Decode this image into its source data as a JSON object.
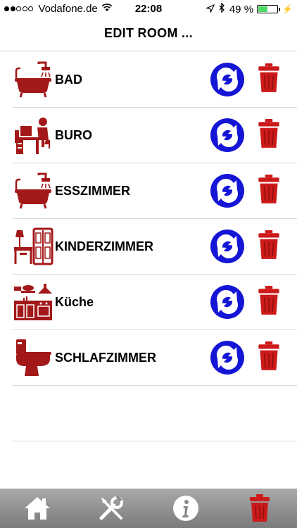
{
  "status_bar": {
    "carrier": "Vodafone.de",
    "time": "22:08",
    "battery": "49 %",
    "battery_level": 0.49
  },
  "header": {
    "title": "EDIT ROOM ..."
  },
  "rooms": [
    {
      "name": "BAD",
      "icon": "bathtub-icon"
    },
    {
      "name": "BURO",
      "icon": "office-desk-icon"
    },
    {
      "name": "ESSZIMMER",
      "icon": "bathtub-icon"
    },
    {
      "name": "KINDERZIMMER",
      "icon": "wardrobe-icon"
    },
    {
      "name": "Küche",
      "icon": "kitchen-icon"
    },
    {
      "name": "SCHLAFZIMMER",
      "icon": "toilet-icon"
    }
  ],
  "toolbar": {
    "items": [
      "home-icon",
      "tools-icon",
      "info-icon",
      "trash-icon"
    ]
  },
  "colors": {
    "accent_red": "#cc1a1a",
    "icon_dark_red": "#a31818",
    "refresh_blue": "#1515d6",
    "toolbar_gray": "#8c8c8c"
  }
}
